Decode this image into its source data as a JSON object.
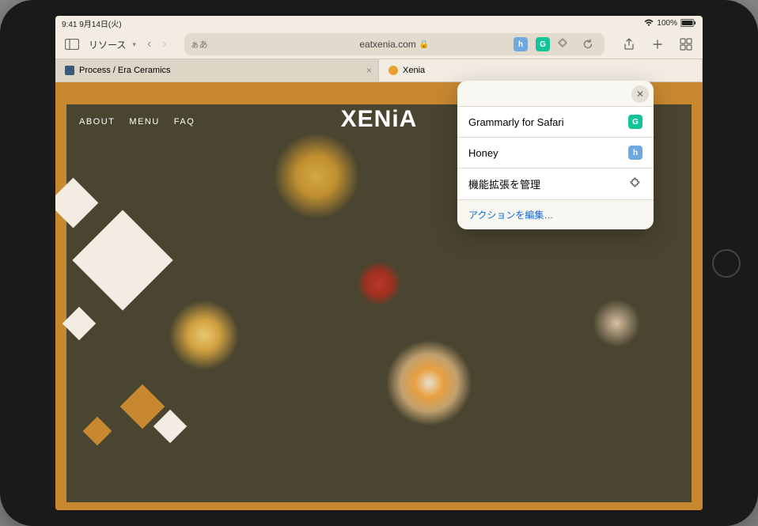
{
  "status": {
    "time": "9:41",
    "date": "9月14日(火)",
    "battery": "100%"
  },
  "toolbar": {
    "resource_label": "リソース",
    "aa_label": "ぁあ",
    "url": "eatxenia.com"
  },
  "tabs": [
    {
      "title": "Process / Era Ceramics",
      "favicon_class": "era",
      "active": false
    },
    {
      "title": "Xenia",
      "favicon_class": "xenia",
      "active": true
    }
  ],
  "page": {
    "nav": {
      "about": "ABOUT",
      "menu": "MENU",
      "faq": "FAQ"
    },
    "logo": "XENiA"
  },
  "popover": {
    "items": [
      {
        "label": "Grammarly for Safari",
        "icon": "grammarly"
      },
      {
        "label": "Honey",
        "icon": "honey"
      },
      {
        "label": "機能拡張を管理",
        "icon": "puzzle"
      }
    ],
    "edit_link": "アクションを編集…"
  }
}
